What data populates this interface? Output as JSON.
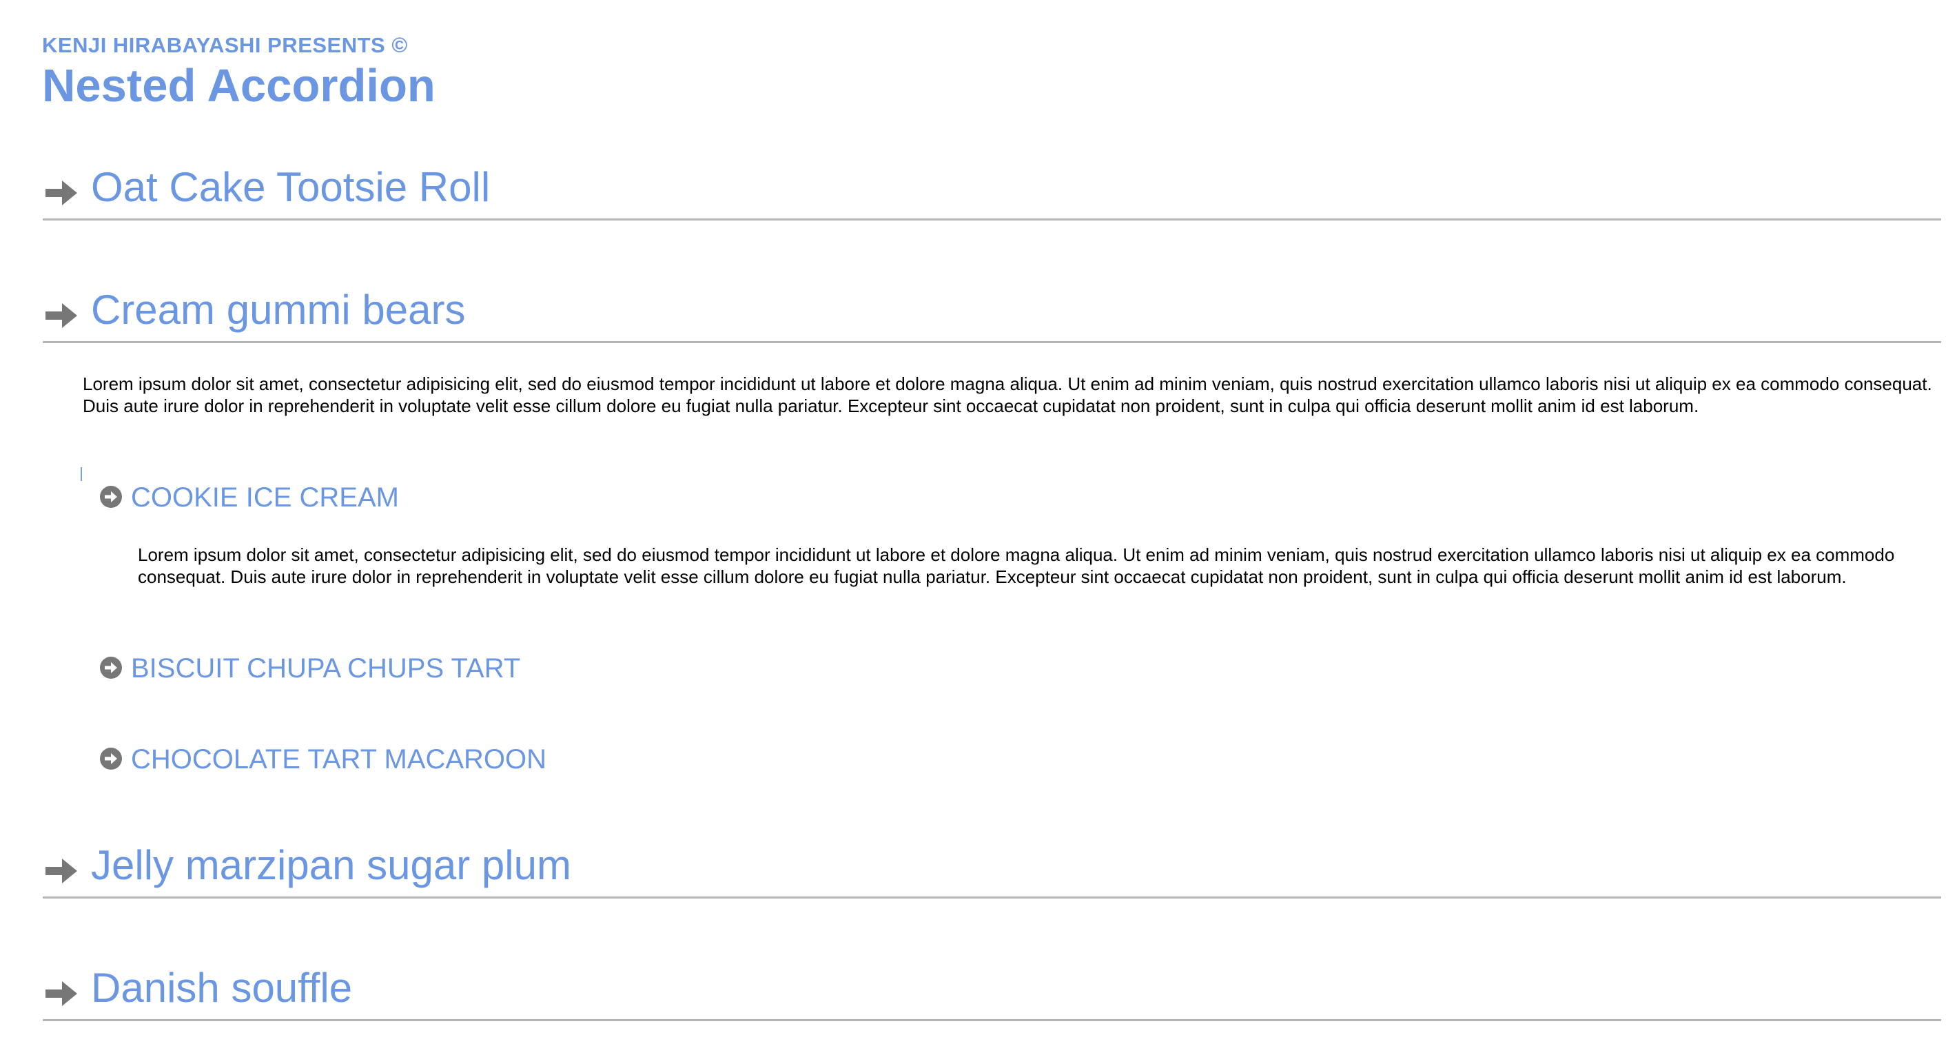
{
  "header": {
    "presents": "KENJI HIRABAYASHI PRESENTS ©",
    "title": "Nested Accordion"
  },
  "accordion": {
    "items": [
      {
        "label": "Oat Cake Tootsie Roll",
        "expanded": false
      },
      {
        "label": "Cream gummi bears",
        "expanded": true
      },
      {
        "label": "Jelly marzipan sugar plum",
        "expanded": false
      },
      {
        "label": "Danish souffle",
        "expanded": false
      }
    ],
    "open_panel": {
      "text": "Lorem ipsum dolor sit amet, consectetur adipisicing elit, sed do eiusmod tempor incididunt ut labore et dolore magna aliqua. Ut enim ad minim veniam, quis nostrud exercitation ullamco laboris nisi ut aliquip ex ea commodo consequat. Duis aute irure dolor in reprehenderit in voluptate velit esse cillum dolore eu fugiat nulla pariatur. Excepteur sint occaecat cupidatat non proident, sunt in culpa qui officia deserunt mollit anim id est laborum.",
      "sub_items": [
        {
          "label": "COOKIE ICE CREAM",
          "expanded": true
        },
        {
          "label": "BISCUIT CHUPA CHUPS TART",
          "expanded": false
        },
        {
          "label": "CHOCOLATE TART MACAROON",
          "expanded": false
        }
      ],
      "sub_panel_text": "Lorem ipsum dolor sit amet, consectetur adipisicing elit, sed do eiusmod tempor incididunt ut labore et dolore magna aliqua. Ut enim ad minim veniam, quis nostrud exercitation ullamco laboris nisi ut aliquip ex ea commodo consequat. Duis aute irure dolor in reprehenderit in voluptate velit esse cillum dolore eu fugiat nulla pariatur. Excepteur sint occaecat cupidatat non proident, sunt in culpa qui officia deserunt mollit anim id est laborum."
    }
  },
  "icons": {
    "section": "arrow-right-icon",
    "subsection": "circle-arrow-right-icon"
  },
  "colors": {
    "accent": "#6a96e2",
    "icon": "#777777",
    "rule": "#b5b5b5",
    "text": "#000000"
  }
}
